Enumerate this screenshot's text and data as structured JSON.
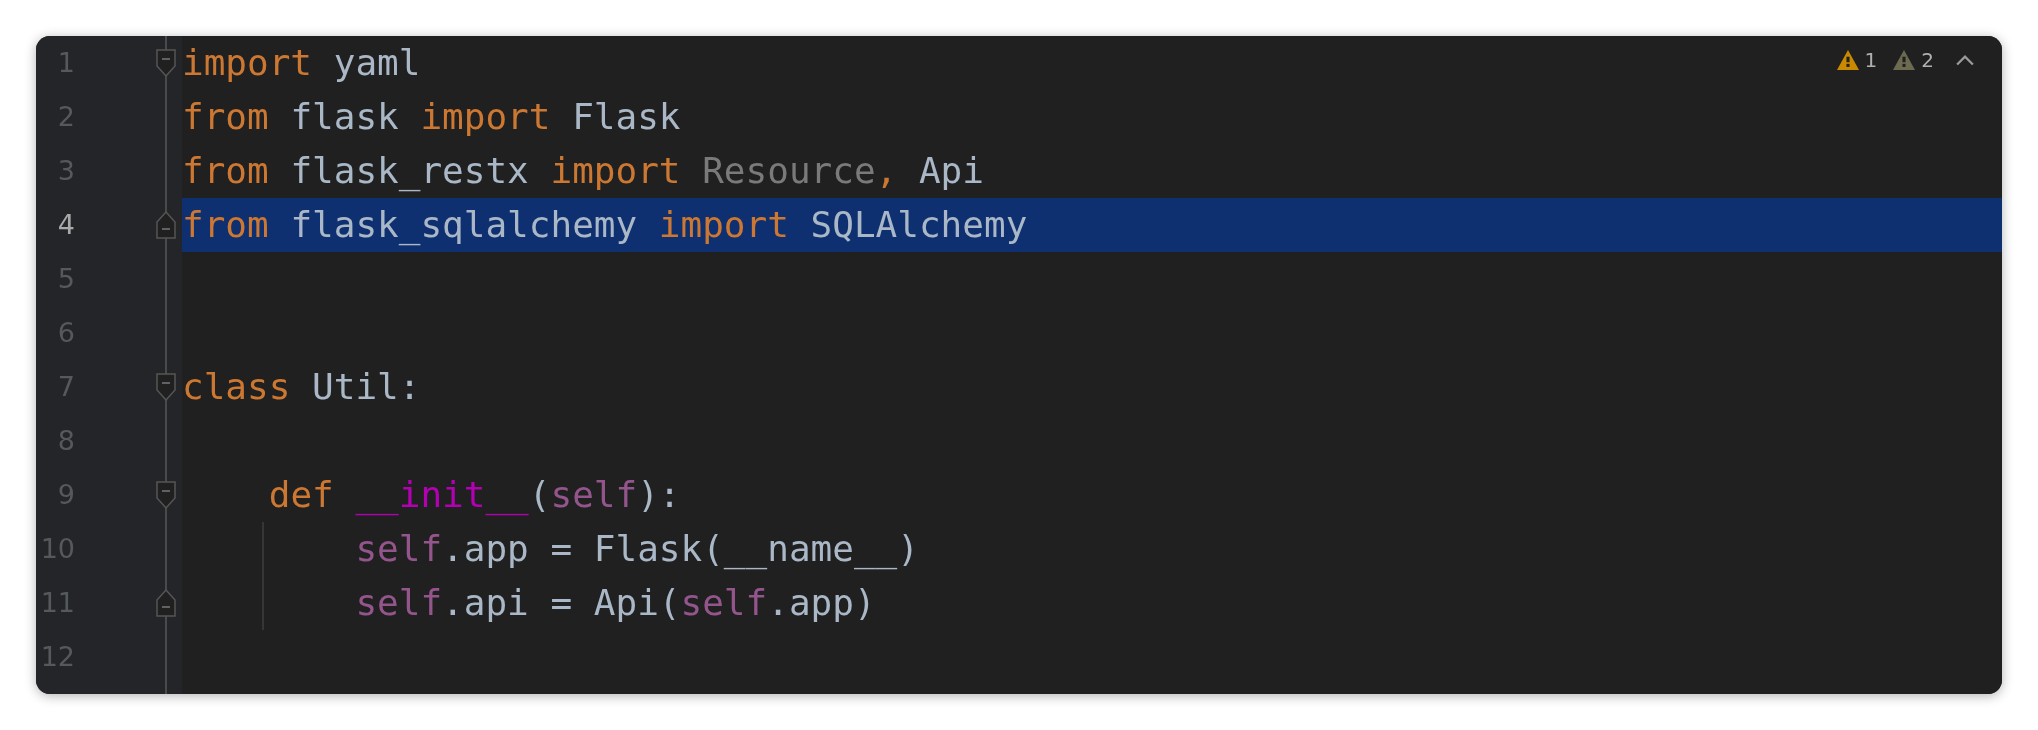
{
  "inspections": [
    {
      "count": "1",
      "color": "#c98a00"
    },
    {
      "count": "2",
      "color": "#6d6a52"
    }
  ],
  "lines": [
    {
      "number": "1",
      "selected": false,
      "fold_start": true,
      "fold_end": false,
      "tokens": [
        {
          "kind": "keyword",
          "text": "import "
        },
        {
          "kind": "ident",
          "text": "yaml"
        }
      ]
    },
    {
      "number": "2",
      "selected": false,
      "fold_start": false,
      "fold_end": false,
      "tokens": [
        {
          "kind": "keyword",
          "text": "from "
        },
        {
          "kind": "ident",
          "text": "flask "
        },
        {
          "kind": "keyword",
          "text": "import "
        },
        {
          "kind": "ident",
          "text": "Flask"
        }
      ]
    },
    {
      "number": "3",
      "selected": false,
      "fold_start": false,
      "fold_end": false,
      "tokens": [
        {
          "kind": "keyword",
          "text": "from "
        },
        {
          "kind": "ident",
          "text": "flask_restx "
        },
        {
          "kind": "keyword",
          "text": "import "
        },
        {
          "kind": "unused",
          "text": "Resource"
        },
        {
          "kind": "keyword",
          "text": ", "
        },
        {
          "kind": "ident",
          "text": "Api"
        }
      ]
    },
    {
      "number": "4",
      "selected": true,
      "fold_start": false,
      "fold_end": true,
      "tokens": [
        {
          "kind": "keyword",
          "text": "from "
        },
        {
          "kind": "ident",
          "text": "flask_sqlalchemy "
        },
        {
          "kind": "keyword",
          "text": "import "
        },
        {
          "kind": "ident",
          "text": "SQLAlchemy"
        }
      ]
    },
    {
      "number": "5",
      "selected": false,
      "fold_start": false,
      "fold_end": false
    },
    {
      "number": "6",
      "selected": false,
      "fold_start": false,
      "fold_end": false
    },
    {
      "number": "7",
      "selected": false,
      "fold_start": true,
      "fold_end": false,
      "tokens": [
        {
          "kind": "keyword",
          "text": "class "
        },
        {
          "kind": "ident",
          "text": "Util:"
        }
      ]
    },
    {
      "number": "8",
      "selected": false,
      "fold_start": false,
      "fold_end": false
    },
    {
      "number": "9",
      "selected": false,
      "fold_start": true,
      "fold_end": false,
      "tokens": [
        {
          "kind": "keyword",
          "text": "    def "
        },
        {
          "kind": "magic",
          "text": "__init__"
        },
        {
          "kind": "ident",
          "text": "("
        },
        {
          "kind": "self",
          "text": "self"
        },
        {
          "kind": "ident",
          "text": "):"
        }
      ]
    },
    {
      "number": "10",
      "selected": false,
      "fold_start": false,
      "fold_end": false,
      "tokens": [
        {
          "kind": "self",
          "text": "        self"
        },
        {
          "kind": "ident",
          "text": ".app = Flask(__name__)"
        }
      ]
    },
    {
      "number": "11",
      "selected": false,
      "fold_start": false,
      "fold_end": true,
      "tokens": [
        {
          "kind": "self",
          "text": "        self"
        },
        {
          "kind": "ident",
          "text": ".api = Api("
        },
        {
          "kind": "self",
          "text": "self"
        },
        {
          "kind": "ident",
          "text": ".app)"
        }
      ]
    },
    {
      "number": "12",
      "selected": false,
      "fold_start": false,
      "fold_end": false
    }
  ]
}
